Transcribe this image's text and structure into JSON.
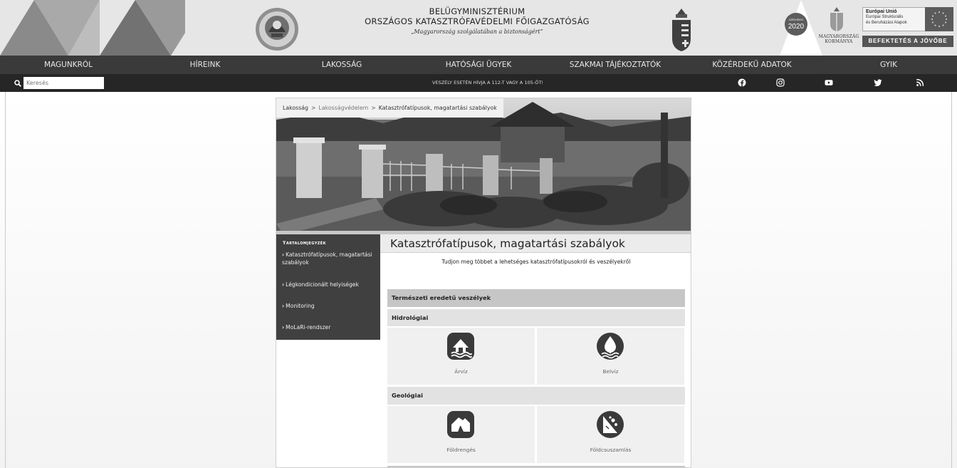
{
  "header": {
    "ministry": "BELÜGYMINISZTÉRIUM",
    "organization": "ORSZÁGOS KATASZTRÓFAVÉDELMI FŐIGAZGATÓSÁG",
    "motto": "„Magyarország szolgálatában a biztonságért”",
    "gov_name_line1": "MAGYARORSZÁG",
    "gov_name_line2": "KORMÁNYA",
    "eu_title": "Európai Unió",
    "eu_line1": "Európai Strukturális",
    "eu_line2": "és Beruházási Alapok",
    "eu_bar": "BEFEKTETÉS A JÖVŐBE"
  },
  "nav": {
    "items": [
      "MAGUNKRÓL",
      "HÍREINK",
      "LAKOSSÁG",
      "HATÓSÁGI ÜGYEK",
      "SZAKMAI TÁJÉKOZTATÓK",
      "KÖZÉRDEKŰ ADATOK",
      "GYIK"
    ]
  },
  "subbar": {
    "search_placeholder": "Keresés",
    "emergency_text": "VESZÉLY ESETÉN HÍVJA A 112-T VAGY A 105-ÖT!",
    "social_icons": [
      "facebook-icon",
      "instagram-icon",
      "youtube-icon",
      "twitter-icon",
      "rss-icon"
    ]
  },
  "breadcrumb": {
    "items": [
      "Lakosság",
      "Lakosságvédelem",
      "Katasztrófatípusok, magatartási szabályok"
    ],
    "separator": ">"
  },
  "toc": {
    "title": "Tartalomjegyzék",
    "items": [
      "Katasztrófatípusok, magatartási szabályok",
      "Légkondicionált helyiségek",
      "Monitoring",
      "MoLaRi-rendszer"
    ]
  },
  "main": {
    "title": "Katasztrófatípusok, magatartási szabályok",
    "intro": "Tudjon meg többet a lehetséges katasztrófatípusokról és veszélyekről",
    "section_title": "Természeti eredetű veszélyek",
    "groups": [
      {
        "name": "Hidrológiai",
        "tiles": [
          {
            "label": "Árvíz",
            "icon": "flood-icon"
          },
          {
            "label": "Belvíz",
            "icon": "inland-water-icon"
          }
        ]
      },
      {
        "name": "Geológiai",
        "tiles": [
          {
            "label": "Földrengés",
            "icon": "earthquake-icon"
          },
          {
            "label": "Földcsuszamlás",
            "icon": "landslide-icon"
          }
        ]
      }
    ]
  },
  "colors": {
    "header_bg": "#e6e6e6",
    "nav_bg": "#3a3a3a",
    "subbar_bg": "#262626",
    "toc_bg": "#404040",
    "section_bg": "#c6c6c6",
    "tile_bg": "#f0f0f0"
  }
}
